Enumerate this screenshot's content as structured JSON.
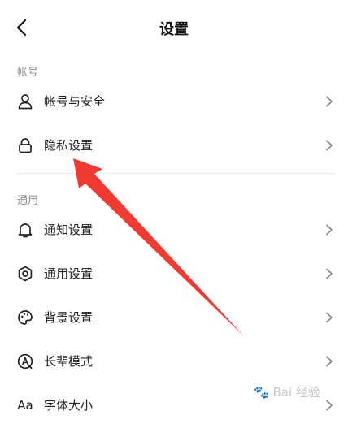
{
  "header": {
    "title": "设置",
    "back_icon": "chevron-left-icon"
  },
  "sections": [
    {
      "label": "帐号",
      "items": [
        {
          "label": "帐号与安全",
          "icon": "user-icon"
        },
        {
          "label": "隐私设置",
          "icon": "lock-icon"
        }
      ]
    },
    {
      "label": "通用",
      "items": [
        {
          "label": "通知设置",
          "icon": "bell-icon"
        },
        {
          "label": "通用设置",
          "icon": "gear-icon"
        },
        {
          "label": "背景设置",
          "icon": "palette-icon"
        },
        {
          "label": "长辈模式",
          "icon": "elder-mode-icon"
        },
        {
          "label": "字体大小",
          "icon": "font-size-icon",
          "icon_text": "Aa"
        }
      ]
    }
  ],
  "annotation": {
    "arrow_color": "#f03a32",
    "points_to": "隐私设置"
  },
  "watermark": {
    "text": "Bai 经验",
    "icon": "baidu-paw-icon"
  },
  "colors": {
    "section_label": "#8a8a8a",
    "text": "#222222",
    "chevron": "#8a8a8a",
    "divider": "#ececec"
  }
}
